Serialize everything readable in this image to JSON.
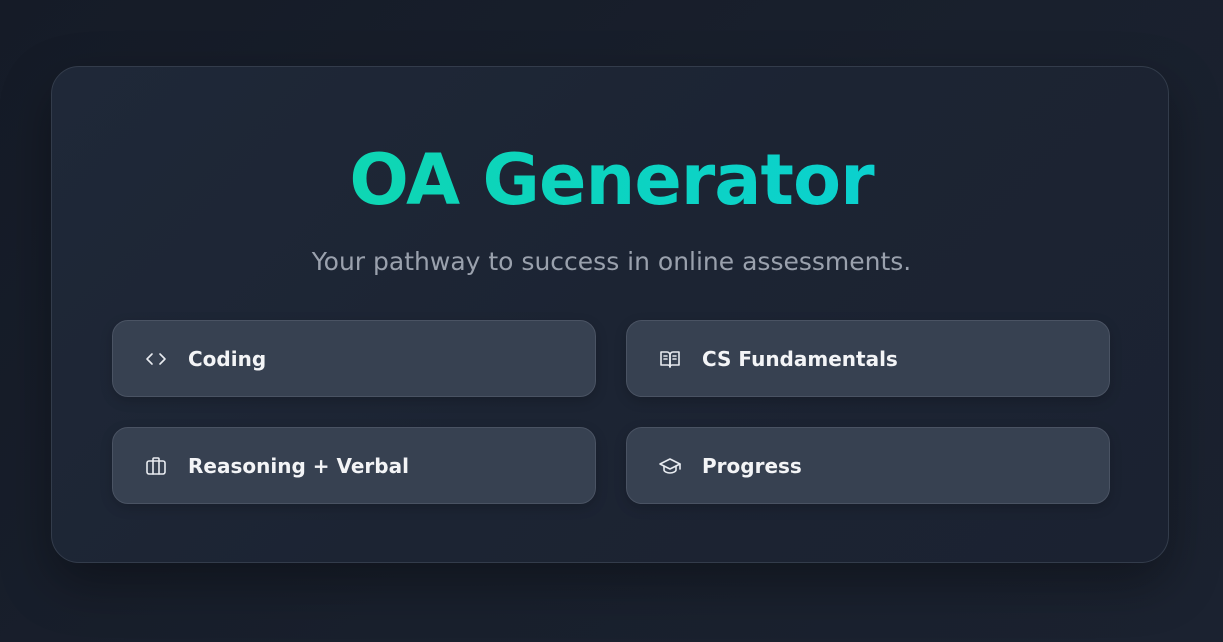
{
  "header": {
    "title": "OA Generator",
    "subtitle": "Your pathway to success in online assessments."
  },
  "menu": {
    "items": [
      {
        "label": "Coding",
        "icon": "code-icon"
      },
      {
        "label": "CS Fundamentals",
        "icon": "book-open-icon"
      },
      {
        "label": "Reasoning + Verbal",
        "icon": "briefcase-icon"
      },
      {
        "label": "Progress",
        "icon": "graduation-cap-icon"
      }
    ]
  },
  "colors": {
    "background": "#171d29",
    "card": "#1e2636",
    "tile": "#374151",
    "title_gradient_start": "#10d9a0",
    "title_gradient_end": "#09cde0",
    "subtitle": "#9aa1ad",
    "tile_text": "#f3f4f6"
  }
}
